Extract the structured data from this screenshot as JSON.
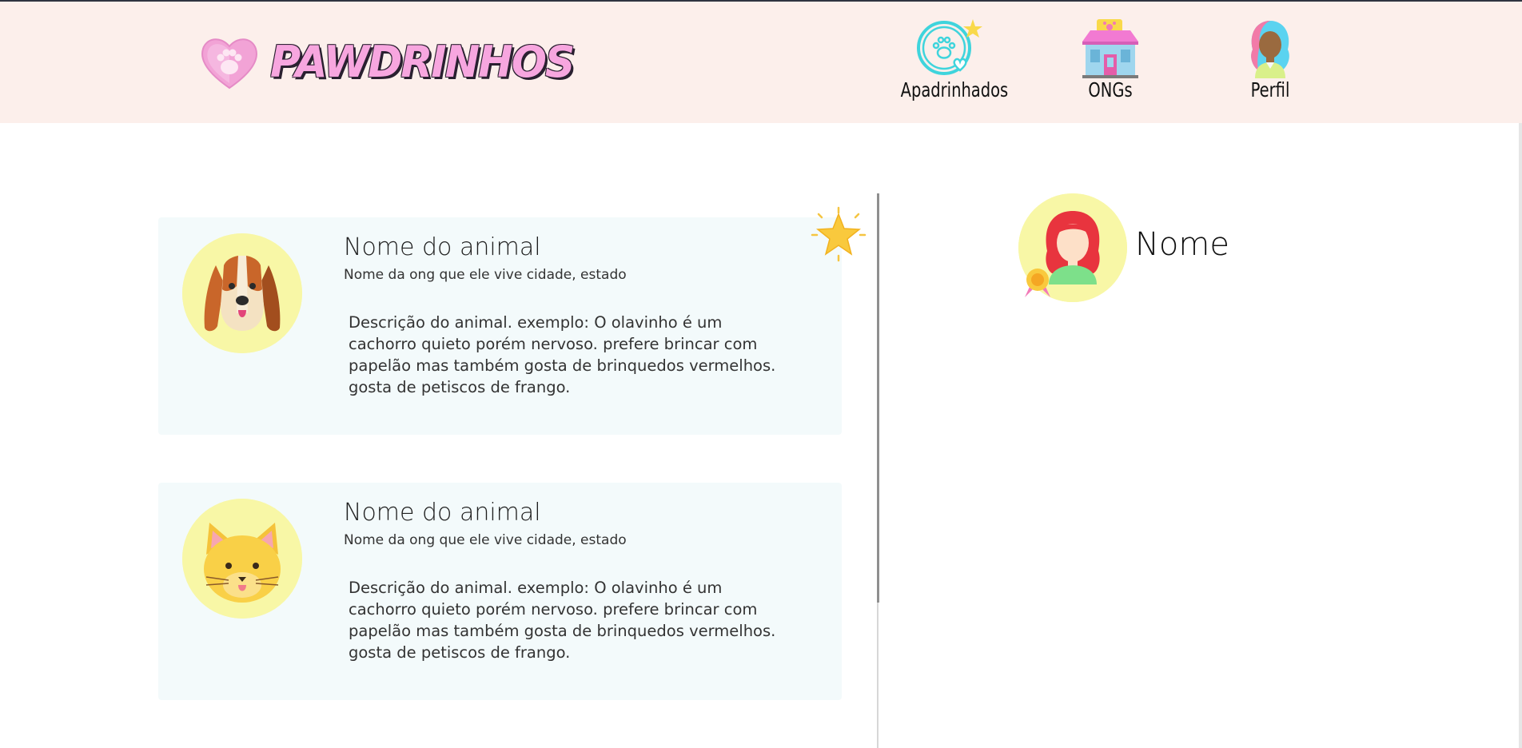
{
  "brand": {
    "name": "PAWDRINHOS",
    "logo_icon": "paw-heart-icon"
  },
  "nav": [
    {
      "label": "Apadrinhados",
      "icon": "paw-badge-icon"
    },
    {
      "label": "ONGs",
      "icon": "shelter-house-icon"
    },
    {
      "label": "Perfil",
      "icon": "user-profile-icon"
    }
  ],
  "animals": [
    {
      "name": "Nome do animal",
      "ong": "Nome da ong que ele vive cidade, estado",
      "description": "Descrição do animal. exemplo: O olavinho é um cachorro quieto porém nervoso. prefere brincar com papelão mas também gosta de brinquedos vermelhos. gosta de petiscos de frango.",
      "icon": "dog-face-icon"
    },
    {
      "name": "Nome do animal",
      "ong": "Nome da ong que ele vive cidade, estado",
      "description": "Descrição do animal. exemplo: O olavinho é um cachorro quieto porém nervoso. prefere brincar com papelão mas também gosta de brinquedos vermelhos. gosta de petiscos de frango.",
      "icon": "cat-face-icon"
    }
  ],
  "profile": {
    "name": "Nome",
    "icon": "woman-avatar-icon",
    "badge_icon": "award-ribbon-icon"
  },
  "colors": {
    "header_bg": "#fcefeb",
    "card_bg": "#f3fafb",
    "avatar_bg": "#f8f7a6",
    "brand_pink": "#f7a6df"
  }
}
